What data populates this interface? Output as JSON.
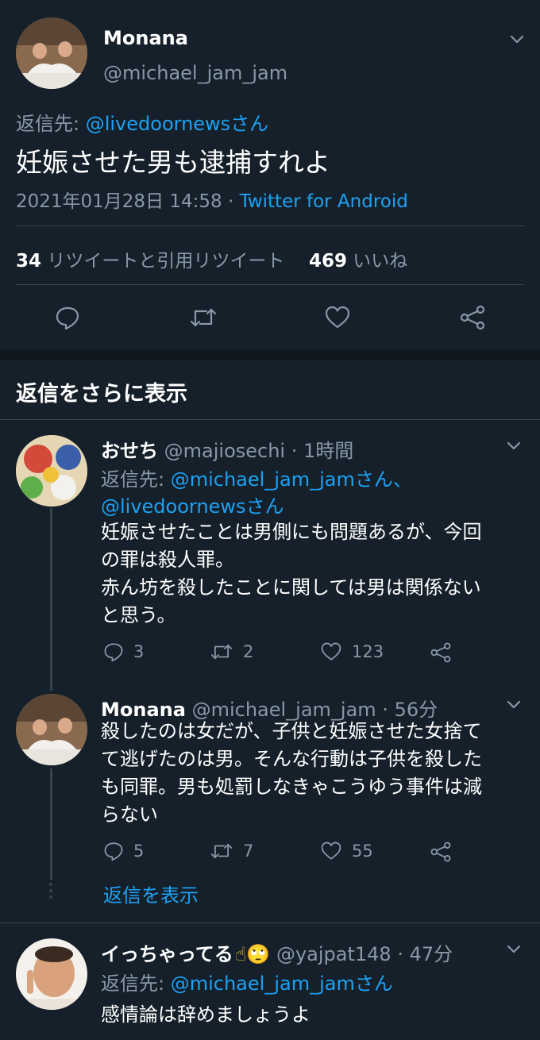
{
  "main_tweet": {
    "name": "Monana",
    "handle": "@michael_jam_jam",
    "reply_prefix": "返信先: ",
    "reply_to": "@livedoornewsさん",
    "text": "妊娠させた男も逮捕すれよ",
    "timestamp": "2021年01月28日 14:58 · ",
    "source": "Twitter for Android",
    "retweet_count": "34",
    "retweet_label": "リツイートと引用リツイート",
    "like_count": "469",
    "like_label": "いいね"
  },
  "more_replies_heading": "返信をさらに表示",
  "replies": [
    {
      "name": "おせち",
      "meta": "@majiosechi · 1時間",
      "reply_prefix": "返信先: ",
      "reply_to_line1": "@michael_jam_jamさん、",
      "reply_to_line2": "@livedoornewsさん",
      "text_lines": [
        "妊娠させたことは男側にも問題あるが、今回",
        "の罪は殺人罪。",
        "赤ん坊を殺したことに関しては男は関係ない",
        "と思う。"
      ],
      "replies_count": "3",
      "retweets_count": "2",
      "likes_count": "123"
    },
    {
      "name": "Monana",
      "meta": "@michael_jam_jam · 56分",
      "text_lines": [
        "殺したのは女だが、子供と妊娠させた女捨て",
        "て逃げたのは男。そんな行動は子供を殺した",
        "も同罪。男も処罰しなきゃこうゆう事件は減",
        "らない"
      ],
      "replies_count": "5",
      "retweets_count": "7",
      "likes_count": "55",
      "show_replies": "返信を表示"
    },
    {
      "name": "イっちゃってる",
      "name_emoji": "☝🙄",
      "meta": "@yajpat148 · 47分",
      "reply_prefix": "返信先: ",
      "reply_to": "@michael_jam_jamさん",
      "text": "感情論は辞めましょうよ"
    }
  ],
  "colors": {
    "background": "#15202b",
    "link": "#1da1f2",
    "muted": "#8899a6",
    "divider": "#38444d"
  },
  "icons": [
    "chevron-down-icon",
    "reply-icon",
    "retweet-icon",
    "like-icon",
    "share-icon"
  ]
}
